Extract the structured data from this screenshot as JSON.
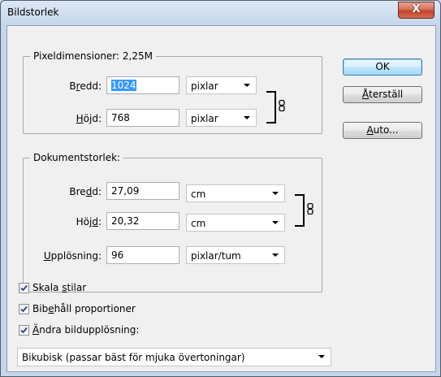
{
  "window": {
    "title": "Bildstorlek",
    "close_symbol": "X"
  },
  "pixel_dimensions": {
    "legend": "Pixeldimensioner: 2,25M",
    "width_label_pre": "B",
    "width_label_ul": "r",
    "width_label_post": "edd:",
    "width_value": "1024",
    "width_unit": "pixlar",
    "height_label_pre": "",
    "height_label_ul": "H",
    "height_label_post": "öjd:",
    "height_value": "768",
    "height_unit": "pixlar",
    "link_icon": "chain-link-icon"
  },
  "document_size": {
    "legend": "Dokumentstorlek:",
    "width_label_pre": "Bre",
    "width_label_ul": "d",
    "width_label_post": "d:",
    "width_value": "27,09",
    "width_unit": "cm",
    "height_label_pre": "Höj",
    "height_label_ul": "d",
    "height_label_post": ":",
    "height_value": "20,32",
    "height_unit": "cm",
    "resolution_label_pre": "",
    "resolution_label_ul": "U",
    "resolution_label_post": "pplösning:",
    "resolution_value": "96",
    "resolution_unit": "pixlar/tum",
    "link_icon": "chain-link-icon"
  },
  "buttons": {
    "ok": "OK",
    "reset_pre": "",
    "reset_ul": "Å",
    "reset_post": "terställ",
    "auto_pre": "",
    "auto_ul": "A",
    "auto_post": "uto..."
  },
  "checkboxes": {
    "scale_styles_pre": "Skala ",
    "scale_styles_ul": "s",
    "scale_styles_post": "tilar",
    "scale_styles_checked": true,
    "constrain_pre": "Bib",
    "constrain_ul": "e",
    "constrain_post": "håll proportioner",
    "constrain_checked": true,
    "resample_pre": "",
    "resample_ul": "Ä",
    "resample_post": "ndra bildupplösning:",
    "resample_checked": true
  },
  "resample_method": "Bikubisk (passar bäst för mjuka övertoningar)"
}
